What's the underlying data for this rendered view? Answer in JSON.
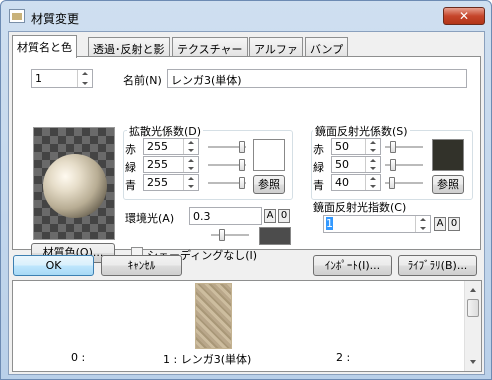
{
  "window": {
    "title": "材質変更",
    "close_label": "✕"
  },
  "tabs": [
    {
      "label": "材質名と色",
      "active": true
    },
    {
      "label": "透過･反射と影",
      "active": false
    },
    {
      "label": "テクスチャー",
      "active": false
    },
    {
      "label": "アルファ",
      "active": false
    },
    {
      "label": "バンプ",
      "active": false
    }
  ],
  "material": {
    "index": "1",
    "name_label": "名前(N)",
    "name_value": "レンガ3(単体)"
  },
  "diffuse": {
    "title": "拡散光係数(D)",
    "r_label": "赤",
    "r": "255",
    "g_label": "緑",
    "g": "255",
    "b_label": "青",
    "b": "255",
    "ref_label": "参照",
    "color": "#ffffff"
  },
  "specular": {
    "title": "鏡面反射光係数(S)",
    "r_label": "赤",
    "r": "50",
    "g_label": "緑",
    "g": "50",
    "b_label": "青",
    "b": "40",
    "ref_label": "参照",
    "color": "#32322a"
  },
  "ambient": {
    "label": "環境光(A)",
    "value": "0.3",
    "a_label": "A",
    "zero_label": "0",
    "color": "#4c4c4c"
  },
  "exponent": {
    "label": "鏡面反射光指数(C)",
    "value": "1",
    "a_label": "A",
    "zero_label": "0"
  },
  "shading": {
    "label": "シェーディングなし(I)",
    "checked": false
  },
  "buttons": {
    "material_color": "材質色(O)...",
    "ok": "OK",
    "cancel": "ｷｬﾝｾﾙ",
    "import": "ｲﾝﾎﾟｰﾄ(I)...",
    "library": "ﾗｲﾌﾞﾗﾘ(B)..."
  },
  "library": {
    "items": [
      {
        "label": "0 :"
      },
      {
        "label": "1 : レンガ3(単体)"
      },
      {
        "label": "2 :"
      }
    ]
  }
}
